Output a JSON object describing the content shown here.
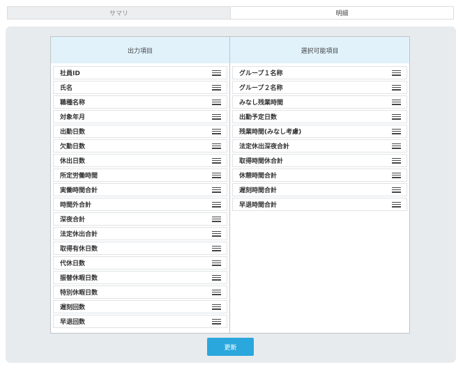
{
  "tabs": [
    {
      "label": "サマリ",
      "active": false
    },
    {
      "label": "明細",
      "active": true
    }
  ],
  "output_column": {
    "header": "出力項目",
    "items": [
      "社員ID",
      "氏名",
      "職種名称",
      "対象年月",
      "出勤日数",
      "欠勤日数",
      "休出日数",
      "所定労働時間",
      "実働時間合計",
      "時間外合計",
      "深夜合計",
      "法定休出合計",
      "取得有休日数",
      "代休日数",
      "振替休暇日数",
      "特別休暇日数",
      "遅刻回数",
      "早退回数"
    ]
  },
  "available_column": {
    "header": "選択可能項目",
    "items": [
      "グループ１名称",
      "グループ２名称",
      "みなし残業時間",
      "出勤予定日数",
      "残業時間(みなし考慮)",
      "法定休出深夜合計",
      "取得時間休合計",
      "休憩時間合計",
      "遅刻時間合計",
      "早退時間合計"
    ]
  },
  "update_button": {
    "label": "更新"
  },
  "colors": {
    "accent": "#2aa7dc",
    "header_bg": "#e1f2fb",
    "panel_bg": "#e8ebee"
  },
  "icons": {
    "drag_handle": "drag-handle-icon"
  }
}
